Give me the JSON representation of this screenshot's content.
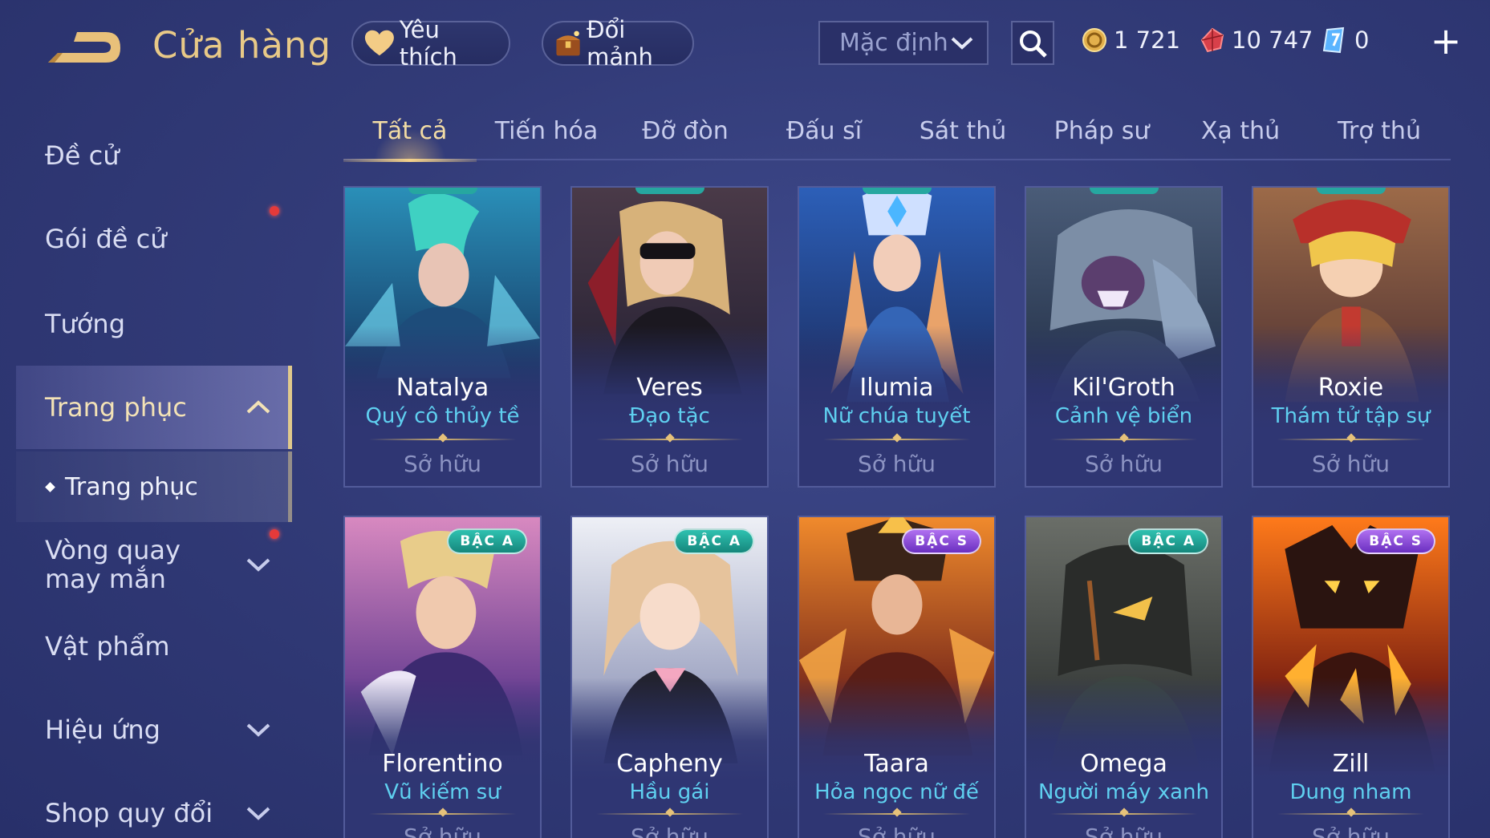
{
  "header": {
    "title": "Cửa hàng",
    "favorite_label": "Yêu thích",
    "fragment_label": "Đổi mảnh",
    "sort_value": "Mặc định",
    "currencies": {
      "gold": "1 721",
      "voucher": "10 747",
      "diamond": "0"
    }
  },
  "sidebar": {
    "items": [
      {
        "label": "Đề cử"
      },
      {
        "label": "Gói đề cử"
      },
      {
        "label": "Tướng"
      },
      {
        "label": "Trang phục"
      },
      {
        "label": "Vòng quay may mắn"
      },
      {
        "label": "Vật phẩm"
      },
      {
        "label": "Hiệu ứng"
      },
      {
        "label": "Shop quy đổi"
      }
    ],
    "sub_item": "Trang phục"
  },
  "tabs": [
    "Tất cả",
    "Tiến hóa",
    "Đỡ đòn",
    "Đấu sĩ",
    "Sát thủ",
    "Pháp sư",
    "Xạ thủ",
    "Trợ thủ"
  ],
  "cards": [
    {
      "hero": "Natalya",
      "skin": "Quý cô thủy tề",
      "status": "Sở hữu"
    },
    {
      "hero": "Veres",
      "skin": "Đạo tặc",
      "status": "Sở hữu"
    },
    {
      "hero": "Ilumia",
      "skin": "Nữ chúa tuyết",
      "status": "Sở hữu"
    },
    {
      "hero": "Kil'Groth",
      "skin": "Cảnh vệ biển",
      "status": "Sở hữu"
    },
    {
      "hero": "Roxie",
      "skin": "Thám tử tập sự",
      "status": "Sở hữu"
    },
    {
      "hero": "Florentino",
      "skin": "Vũ kiếm sư",
      "status": "Sở hữu",
      "rank": "BẬC A"
    },
    {
      "hero": "Capheny",
      "skin": "Hầu gái",
      "status": "Sở hữu",
      "rank": "BẬC A"
    },
    {
      "hero": "Taara",
      "skin": "Hỏa ngọc nữ đế",
      "status": "Sở hữu",
      "rank": "BẬC S"
    },
    {
      "hero": "Omega",
      "skin": "Người máy xanh",
      "status": "Sở hữu",
      "rank": "BẬC A"
    },
    {
      "hero": "Zill",
      "skin": "Dung nham",
      "status": "Sở hữu",
      "rank": "BẬC S"
    }
  ],
  "colors": {
    "accent_gold": "#e8c987",
    "skin_name": "#5fd0f0",
    "background": "#323b78"
  }
}
